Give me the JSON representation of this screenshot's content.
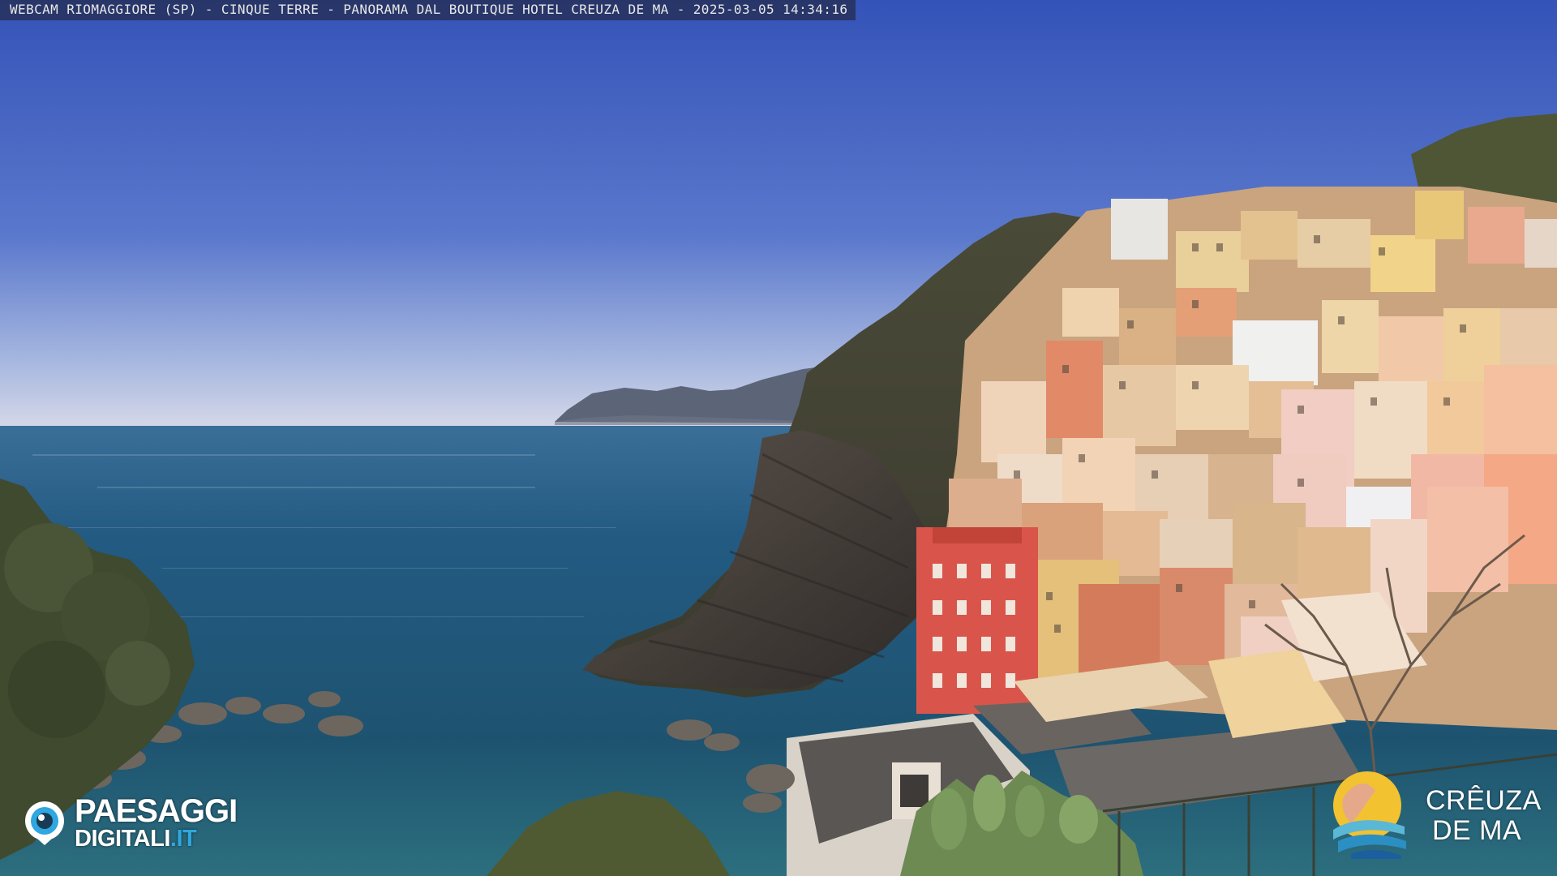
{
  "overlay": {
    "caption": "WEBCAM RIOMAGGIORE (SP) - CINQUE TERRE - PANORAMA DAL BOUTIQUE HOTEL CREUZA DE MA - 2025-03-05 14:34:16"
  },
  "logos": {
    "left": {
      "line1": "PAESAGGI",
      "line2_main": "DIGITALI",
      "line2_tld": ".IT",
      "icon": "eye-icon",
      "accent": "#2fa7e0"
    },
    "right": {
      "line1": "CRÊUZA",
      "line2": "DE MA",
      "icon": "sun-sea-icon",
      "accent": "#f2c230"
    }
  },
  "colors": {
    "sky_top": "#3554b8",
    "sky_horizon": "#c9d4ea",
    "sea_deep": "#1f4f6e",
    "sea_near": "#2b6f86",
    "cliff": "#4a4541",
    "vegetation": "#4f5a35"
  }
}
